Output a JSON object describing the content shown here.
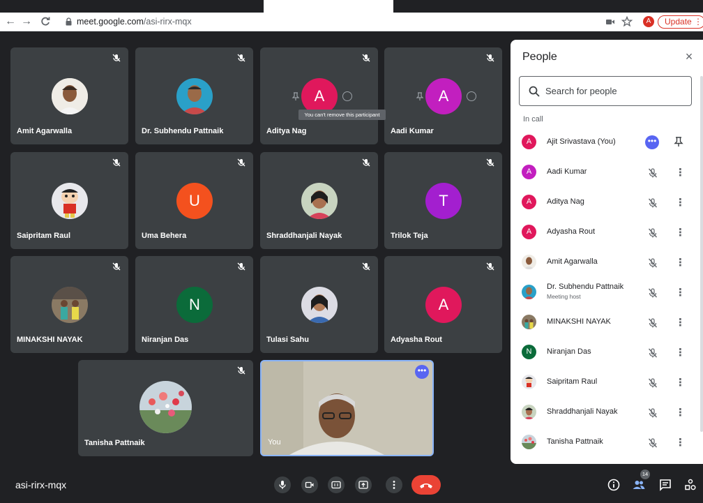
{
  "browser": {
    "url_host": "meet.google.com",
    "url_path": "/asi-rirx-mqx",
    "profile_initial": "A",
    "update_label": "Update",
    "update_dots": "⋮"
  },
  "tiles": [
    {
      "name": "Amit Agarwalla"
    },
    {
      "name": "Dr. Subhendu Pattnaik"
    },
    {
      "name": "Aditya Nag",
      "initial": "A",
      "tooltip": "You can't remove this participant"
    },
    {
      "name": "Aadi Kumar",
      "initial": "A"
    },
    {
      "name": "Saipritam Raul"
    },
    {
      "name": "Uma Behera",
      "initial": "U"
    },
    {
      "name": "Shraddhanjali Nayak"
    },
    {
      "name": "Trilok Teja",
      "initial": "T"
    },
    {
      "name": "MINAKSHI NAYAK"
    },
    {
      "name": "Niranjan Das",
      "initial": "N"
    },
    {
      "name": "Tulasi Sahu"
    },
    {
      "name": "Adyasha Rout",
      "initial": "A"
    },
    {
      "name": "Tanisha Pattnaik"
    },
    {
      "name": "You"
    }
  ],
  "colors": {
    "accent": "#8ab4f8",
    "avatar_pink": "#e0185c",
    "avatar_magenta": "#c21fbf",
    "avatar_orange": "#f4511e",
    "avatar_purple": "#a31fcf",
    "avatar_green": "#0b6b3a",
    "end_call": "#ea4335"
  },
  "panel": {
    "title": "People",
    "close": "×",
    "search_placeholder": "Search for people",
    "section": "In call",
    "people": [
      {
        "name": "Ajit Srivastava (You)",
        "initial": "A"
      },
      {
        "name": "Aadi Kumar",
        "initial": "A"
      },
      {
        "name": "Aditya Nag",
        "initial": "A"
      },
      {
        "name": "Adyasha Rout",
        "initial": "A"
      },
      {
        "name": "Amit Agarwalla"
      },
      {
        "name": "Dr. Subhendu Pattnaik",
        "role": "Meeting host"
      },
      {
        "name": "MINAKSHI NAYAK"
      },
      {
        "name": "Niranjan Das",
        "initial": "N"
      },
      {
        "name": "Saipritam Raul"
      },
      {
        "name": "Shraddhanjali Nayak"
      },
      {
        "name": "Tanisha Pattnaik"
      }
    ],
    "more_glyph": "⋮",
    "you_dots": "•••"
  },
  "bottom": {
    "meeting_code": "asi-rirx-mqx",
    "participant_count": "14"
  }
}
